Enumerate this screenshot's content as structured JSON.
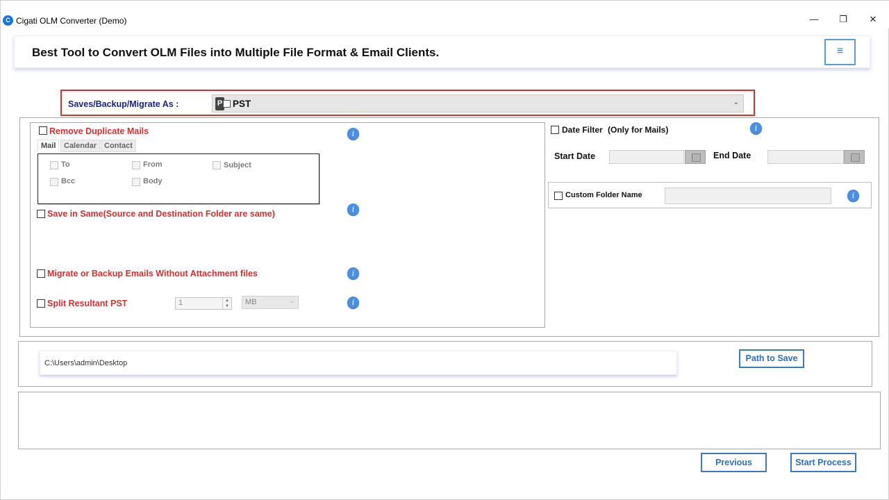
{
  "window": {
    "title": "Cigati OLM Converter (Demo)",
    "app_icon_glyph": "C",
    "controls": {
      "minimize": "—",
      "maximize": "❐",
      "close": "✕"
    }
  },
  "banner": {
    "headline": "Best Tool to Convert OLM Files into Multiple File Format & Email Clients.",
    "menu_icon": "≡"
  },
  "save_as": {
    "label": "Saves/Backup/Migrate As :",
    "selected": "PST",
    "icon_letter": "P"
  },
  "duplicate": {
    "label": "Remove Duplicate Mails",
    "tabs": [
      "Mail",
      "Calendar",
      "Contact"
    ],
    "fields": [
      "To",
      "From",
      "Subject",
      "Bcc",
      "Body"
    ]
  },
  "options": {
    "save_in_same": "Save in Same(Source and Destination Folder are same)",
    "without_attachments": "Migrate or Backup Emails Without Attachment files",
    "split": "Split Resultant PST",
    "split_value": "1",
    "split_unit": "MB"
  },
  "date_filter": {
    "label": "Date Filter",
    "note": "(Only for Mails)",
    "start_label": "Start Date",
    "end_label": "End Date"
  },
  "custom_folder": {
    "label": "Custom Folder Name"
  },
  "path": {
    "value": "C:\\Users\\admin\\Desktop",
    "button": "Path to Save"
  },
  "footer": {
    "previous": "Previous",
    "start": "Start Process"
  },
  "info_glyph": "i",
  "colors": {
    "accent": "#3a78c2",
    "warning_red": "#d32f2f",
    "label_navy": "#1a237e"
  }
}
